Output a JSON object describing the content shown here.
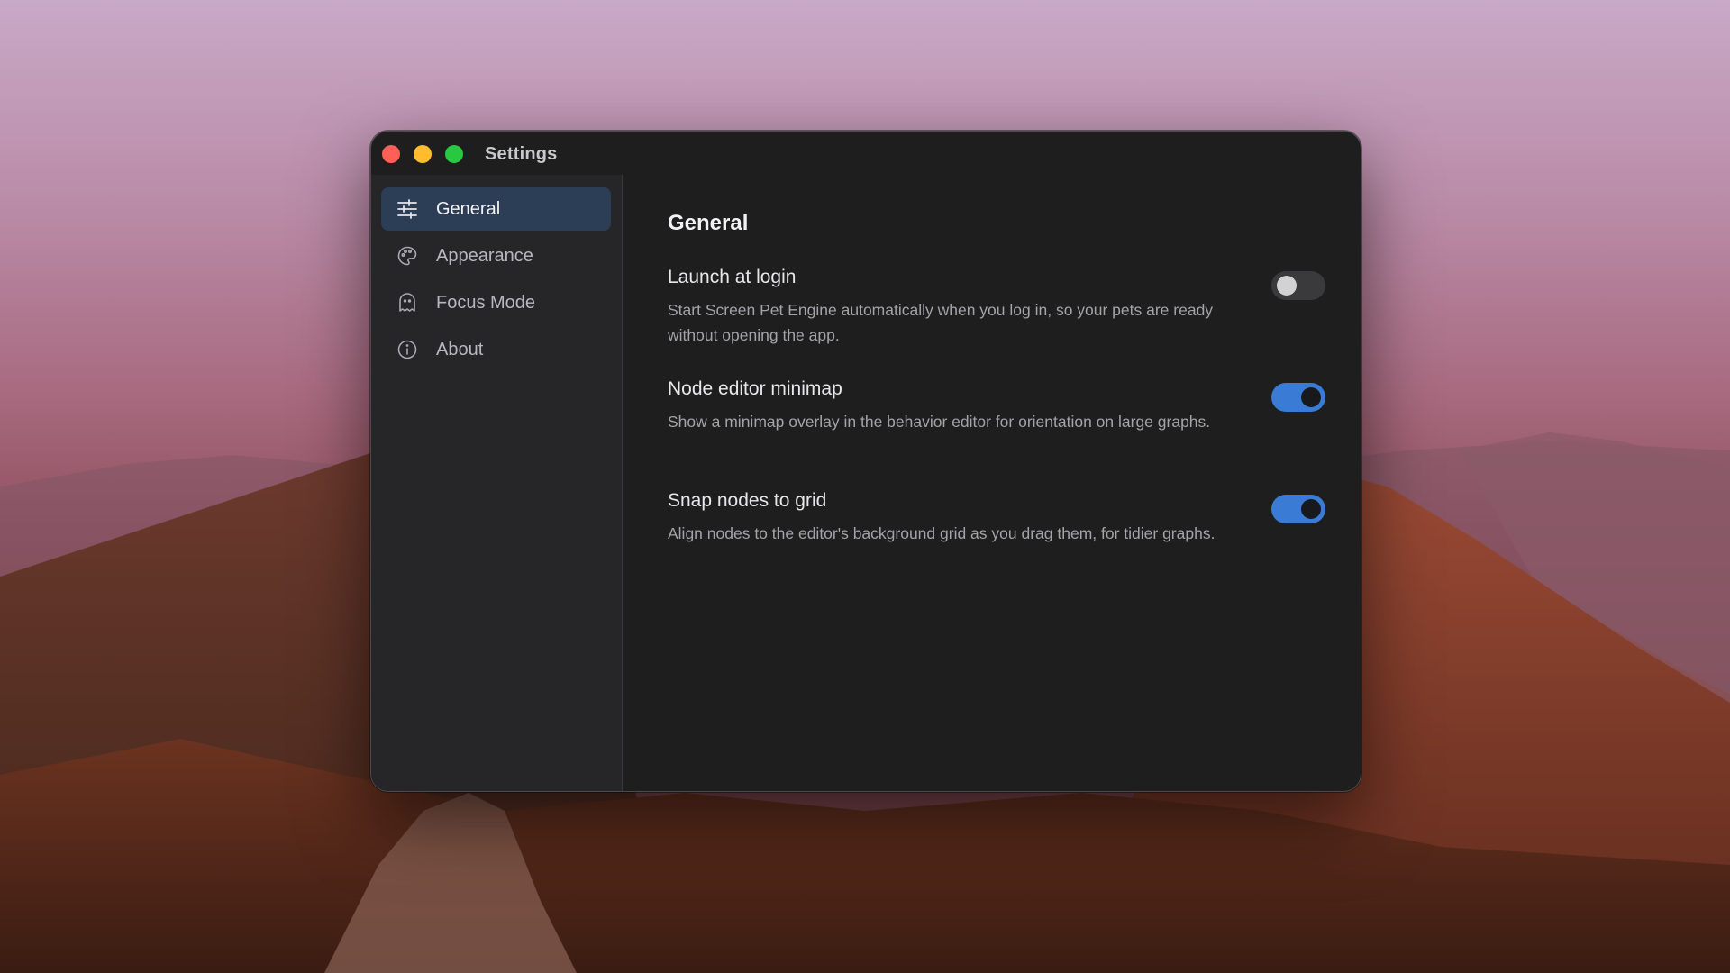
{
  "window": {
    "title": "Settings"
  },
  "sidebar": {
    "items": [
      {
        "label": "General",
        "icon": "sliders-icon",
        "active": true
      },
      {
        "label": "Appearance",
        "icon": "palette-icon",
        "active": false
      },
      {
        "label": "Focus Mode",
        "icon": "ghost-icon",
        "active": false
      },
      {
        "label": "About",
        "icon": "info-icon",
        "active": false
      }
    ]
  },
  "main": {
    "section_title": "General",
    "settings": [
      {
        "title": "Launch at login",
        "description": "Start Screen Pet Engine automatically when you log in, so your pets are ready without opening the app.",
        "enabled": false
      },
      {
        "title": "Node editor minimap",
        "description": "Show a minimap overlay in the behavior editor for orientation on large graphs.",
        "enabled": true
      },
      {
        "title": "Snap nodes to grid",
        "description": "Align nodes to the editor's background grid as you drag them, for tidier graphs.",
        "enabled": true
      }
    ]
  },
  "colors": {
    "accent": "#3a7bd5",
    "sidebar_active": "#2c3e56",
    "window_bg": "#1e1e1f",
    "sidebar_bg": "#262628",
    "close": "#ff5f57",
    "minimize": "#febc2e",
    "zoom": "#28c840"
  }
}
